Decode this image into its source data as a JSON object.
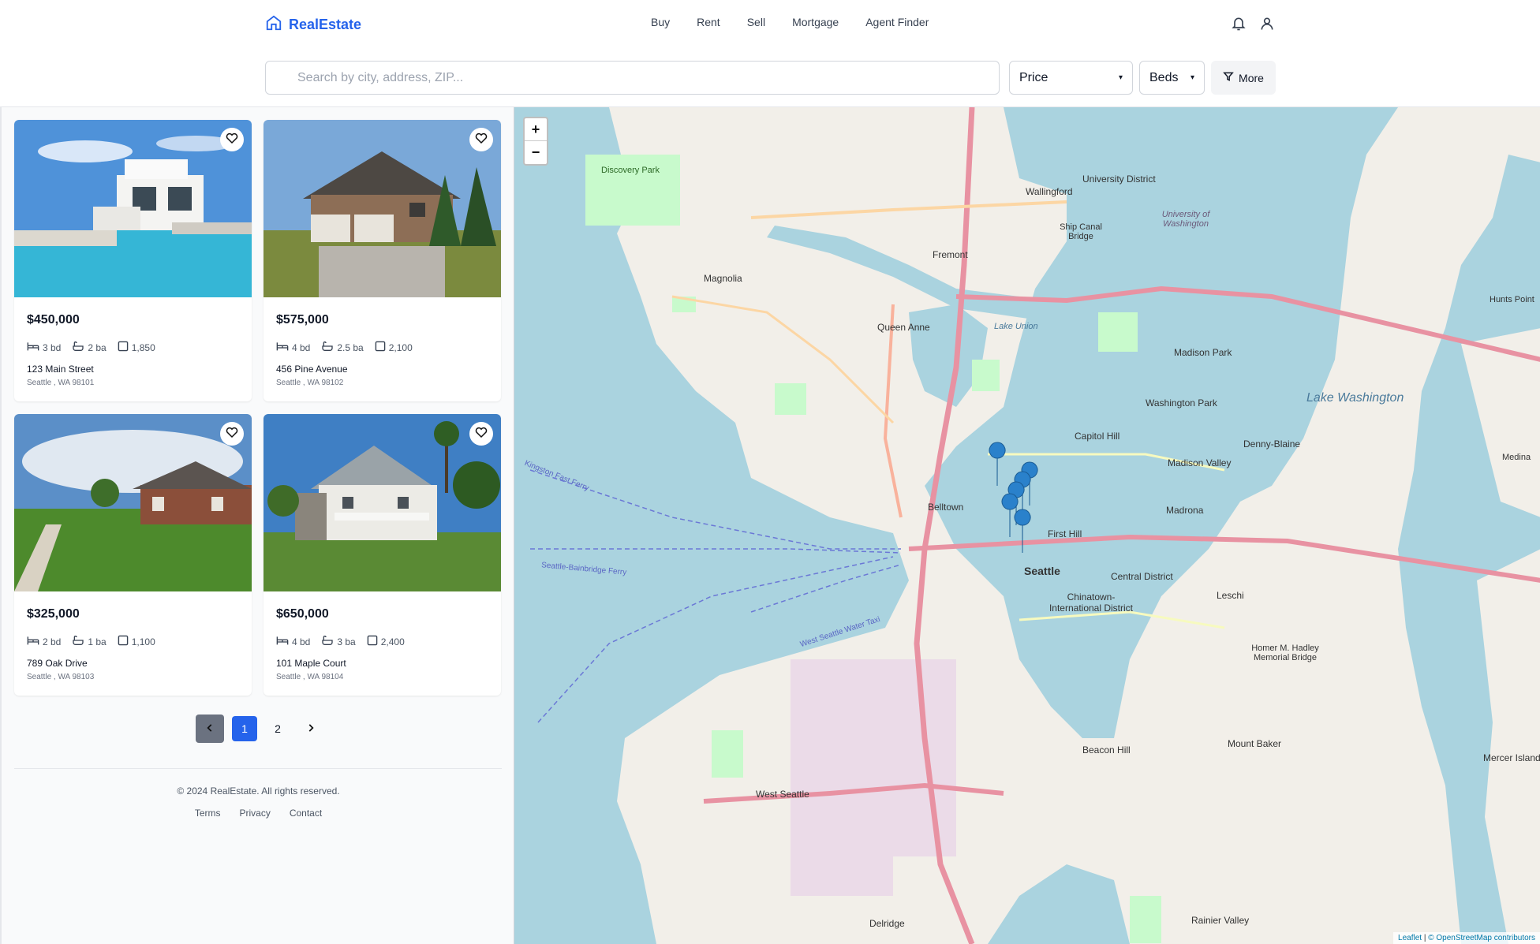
{
  "header": {
    "brand": "RealEstate",
    "nav": [
      "Buy",
      "Rent",
      "Sell",
      "Mortgage",
      "Agent Finder"
    ]
  },
  "search": {
    "placeholder": "Search by city, address, ZIP...",
    "price_label": "Price",
    "beds_label": "Beds",
    "more_label": "More"
  },
  "listings": [
    {
      "price": "$450,000",
      "beds": "3 bd",
      "baths": "2 ba",
      "sqft": "1,850",
      "address": "123 Main Street",
      "city": "Seattle",
      "state": "WA",
      "zip": "98101"
    },
    {
      "price": "$575,000",
      "beds": "4 bd",
      "baths": "2.5 ba",
      "sqft": "2,100",
      "address": "456 Pine Avenue",
      "city": "Seattle",
      "state": "WA",
      "zip": "98102"
    },
    {
      "price": "$325,000",
      "beds": "2 bd",
      "baths": "1 ba",
      "sqft": "1,100",
      "address": "789 Oak Drive",
      "city": "Seattle",
      "state": "WA",
      "zip": "98103"
    },
    {
      "price": "$650,000",
      "beds": "4 bd",
      "baths": "3 ba",
      "sqft": "2,400",
      "address": "101 Maple Court",
      "city": "Seattle",
      "state": "WA",
      "zip": "98104"
    }
  ],
  "pagination": {
    "pages": [
      "1",
      "2"
    ],
    "current": "1"
  },
  "footer": {
    "copyright": "© 2024 RealEstate. All rights reserved.",
    "links": [
      "Terms",
      "Privacy",
      "Contact"
    ]
  },
  "map": {
    "zoom_in": "+",
    "zoom_out": "−",
    "attribution_leaflet": "Leaflet",
    "attribution_osm": "© OpenStreetMap contributors",
    "labels": [
      "Wallingford",
      "University District",
      "Fremont",
      "Magnolia",
      "Queen Anne",
      "Discovery Park",
      "Madison Park",
      "Lake Washington",
      "Washington Park",
      "Capitol Hill",
      "Denny-Blaine",
      "Madison Valley",
      "Belltown",
      "Madrona",
      "First Hill",
      "Seattle",
      "Central District",
      "Leschi",
      "Chinatown-International District",
      "Homer M. Hadley Memorial Bridge",
      "Mount Baker",
      "Beacon Hill",
      "West Seattle",
      "Delridge",
      "Rainier Valley",
      "Hunts Point",
      "Medina",
      "Mercer Island",
      "Ship Canal Bridge",
      "Lake Union",
      "University of Washington",
      "Seattle-Bainbridge Ferry",
      "Kingston Fast Ferry",
      "West Seattle Water Taxi"
    ]
  },
  "colors": {
    "accent": "#2563eb",
    "water": "#aad3df",
    "land": "#f2efe9",
    "marker": "#2a81cb"
  }
}
